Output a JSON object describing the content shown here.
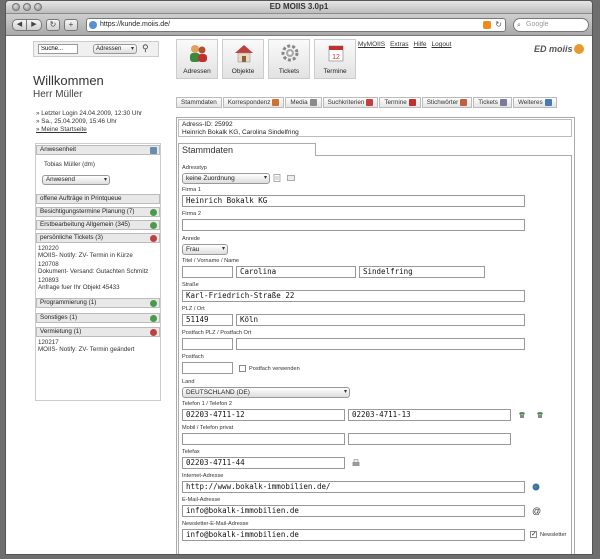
{
  "browser": {
    "title": "ED MOIIS 3.0p1",
    "url": "https://kunde.moiis.de/",
    "search_placeholder": "Google"
  },
  "topbar": {
    "search_value": "Suche...",
    "search_scope": "Adressen"
  },
  "modules": [
    {
      "label": "Adressen"
    },
    {
      "label": "Objekte"
    },
    {
      "label": "Tickets"
    },
    {
      "label": "Termine"
    }
  ],
  "toplinks": [
    "MyMOIIS",
    "Extras",
    "Hilfe",
    "Logout"
  ],
  "brand": "ED moiis",
  "welcome": {
    "line1": "Willkommen",
    "line2": "Herr Müller",
    "last_login": "» Letzter Login 24.04.2009, 12:30 Uhr",
    "now": "» Sa., 25.04.2009, 15:46 Uhr",
    "startpage": "» Meine Startseite"
  },
  "left": {
    "anwesenheit_title": "Anwesenheit",
    "user": "Tobias Müller (dm)",
    "status": "Anwesend",
    "panels": [
      {
        "title": "offene Aufträge in Printqueue"
      },
      {
        "title": "Besichtigungstermine Planung (7)"
      },
      {
        "title": "Erstbearbeitung Allgemein (345)"
      },
      {
        "title": "persönliche Tickets (3)"
      }
    ],
    "tickets": [
      {
        "id": "120220",
        "text": "MOIIS- Notify: ZV- Termin in Kürze"
      },
      {
        "id": "120708",
        "text": "Dokument- Versand: Gutachten Schmitz"
      },
      {
        "id": "120893",
        "text": "Anfrage fuer Ihr Objekt 45433"
      }
    ],
    "panels2": [
      {
        "title": "Programmierung (1)"
      },
      {
        "title": "Sonstiges (1)"
      },
      {
        "title": "Vermietung (1)"
      }
    ],
    "vermietung_ticket": {
      "id": "120217",
      "text": "MOIIS- Notify: ZV- Termin geändert"
    }
  },
  "tabs": [
    "Stammdaten",
    "Korrespondenz",
    "Media",
    "Suchkriterien",
    "Termine",
    "Stichwörter",
    "Tickets",
    "Weiteres"
  ],
  "address": {
    "id_line": "Adress-ID: 25992",
    "name_line": "Heinrich Bokalk KG, Carolina Sindelfring"
  },
  "form": {
    "section_title": "Stammdaten",
    "adresstyp_label": "Adresstyp",
    "adresstyp_value": "keine Zuordnung",
    "firma1_label": "Firma 1",
    "firma1_value": "Heinrich Bokalk KG",
    "firma2_label": "Firma 2",
    "anrede_label": "Anrede",
    "anrede_value": "Frau",
    "name_label": "Titel / Vorname / Name",
    "vorname_value": "Carolina",
    "nachname_value": "Sindelfring",
    "strasse_label": "Straße",
    "strasse_value": "Karl-Friedrich-Straße 22",
    "plzort_label": "PLZ / Ort",
    "plz_value": "51149",
    "ort_value": "Köln",
    "postfach_plz_label": "Postfach PLZ / Postfach Ort",
    "postfach_label": "Postfach",
    "postfach_cb_label": "Postfach verwenden",
    "land_label": "Land",
    "land_value": "DEUTSCHLAND (DE)",
    "telefon_label": "Telefon 1 / Telefon 2",
    "telefon1_value": "02203-4711-12",
    "telefon2_value": "02203-4711-13",
    "mobil_label": "Mobil / Telefon privat",
    "telefax_label": "Telefax",
    "telefax_value": "02203-4711-44",
    "internet_label": "Internet-Adresse",
    "internet_value": "http://www.bokalk-immobilien.de/",
    "email_label": "E-Mail-Adresse",
    "email_value": "info@bokalk-immobilien.de",
    "newsletter_email_label": "Newsletter-E-Mail-Adresse",
    "newsletter_email_value": "info@bokalk-immobilien.de",
    "newsletter_cb_label": "Newsletter"
  }
}
